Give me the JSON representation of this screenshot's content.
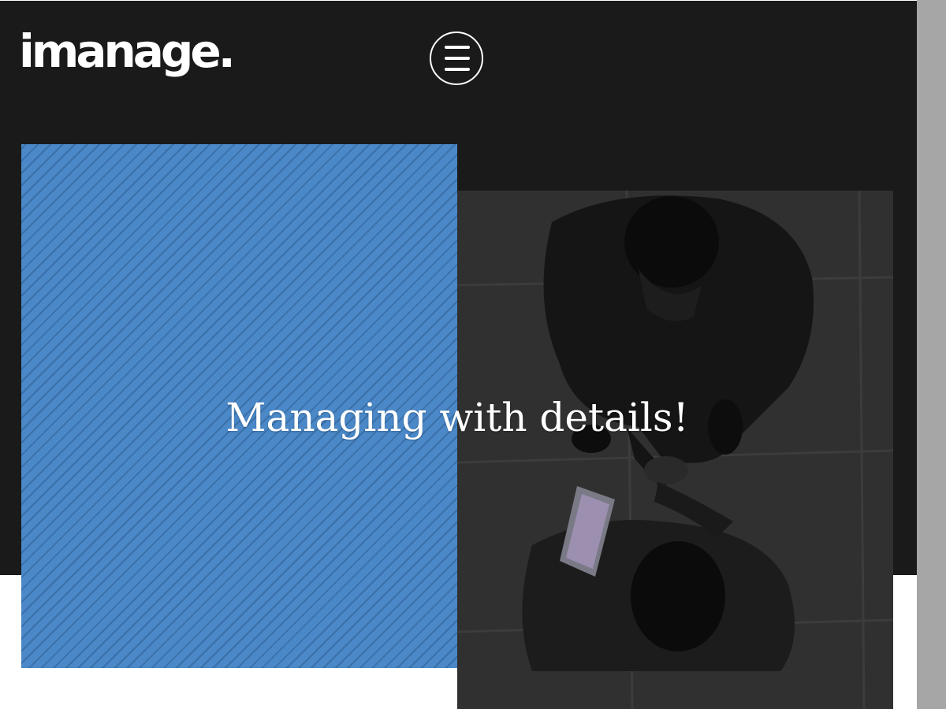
{
  "header": {
    "logo_text": "imanage.",
    "menu_icon": "hamburger-menu-icon"
  },
  "hero": {
    "headline": "Managing with details!",
    "photo_description_icon": "handshake-photo"
  },
  "colors": {
    "header_bg": "#1a1a1a",
    "accent_blue": "#4a88c8",
    "stripe_blue": "#3b70a8",
    "scrollbar": "#a6a6a6"
  }
}
